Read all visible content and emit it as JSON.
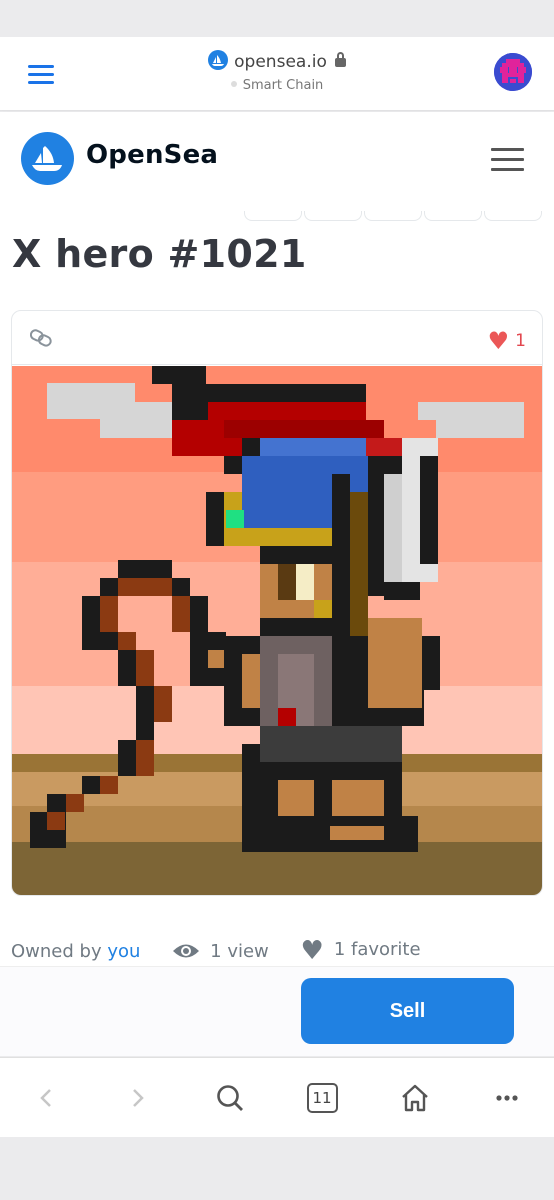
{
  "browser": {
    "site": "opensea.io",
    "network": "Smart Chain",
    "tab_count": "11"
  },
  "header": {
    "brand": "OpenSea"
  },
  "item": {
    "title": "X hero #1021",
    "favorites_count": "1",
    "owned_prefix": "Owned by ",
    "owner": "you",
    "views": "1 view",
    "favorites": "1 favorite"
  },
  "actions": {
    "sell_label": "Sell"
  },
  "icons": [
    "menu-icon",
    "opensea-logo-icon",
    "lock-icon",
    "hamburger-icon",
    "chain-link-icon",
    "heart-icon",
    "eye-icon",
    "back-icon",
    "forward-icon",
    "search-icon",
    "tabs-icon",
    "home-icon",
    "more-icon"
  ],
  "colors": {
    "accent": "#2081e2",
    "heart": "#eb5757",
    "text": "#353840",
    "muted": "#707a83"
  }
}
